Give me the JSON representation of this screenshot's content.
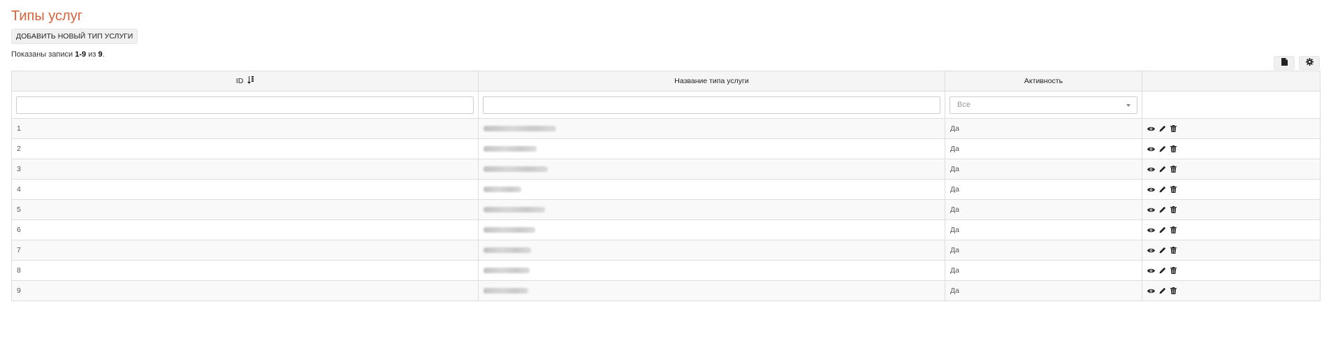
{
  "page": {
    "title": "Типы услуг",
    "add_button_label": "ДОБАВИТЬ НОВЫЙ ТИП УСЛУГИ",
    "summary": {
      "prefix": "Показаны записи ",
      "range": "1-9",
      "middle": " из ",
      "total": "9",
      "suffix": "."
    }
  },
  "toolbar": {
    "export_icon": "file-icon",
    "settings_icon": "gear-icon"
  },
  "table": {
    "headers": {
      "id": "ID",
      "name": "Название типа услуги",
      "active": "Активность",
      "actions": ""
    },
    "filters": {
      "id_value": "",
      "name_value": "",
      "active_selected": "Все"
    },
    "rows": [
      {
        "id": "1",
        "name": "",
        "active": "Да"
      },
      {
        "id": "2",
        "name": "",
        "active": "Да"
      },
      {
        "id": "3",
        "name": "",
        "active": "Да"
      },
      {
        "id": "4",
        "name": "",
        "active": "Да"
      },
      {
        "id": "5",
        "name": "",
        "active": "Да"
      },
      {
        "id": "6",
        "name": "",
        "active": "Да"
      },
      {
        "id": "7",
        "name": "",
        "active": "Да"
      },
      {
        "id": "8",
        "name": "",
        "active": "Да"
      },
      {
        "id": "9",
        "name": "",
        "active": "Да"
      }
    ],
    "row_action_icons": [
      "eye-icon",
      "pencil-icon",
      "trash-icon"
    ]
  },
  "colors": {
    "title": "#d9623b",
    "header_bg": "#f5f5f5",
    "stripe_bg": "#f9f9f9",
    "border": "#dddddd"
  }
}
